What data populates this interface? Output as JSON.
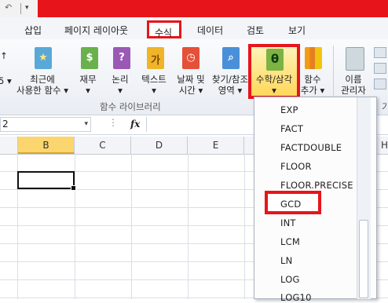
{
  "titlebar": {
    "dropdown_glyph": "▾"
  },
  "tabs": [
    {
      "label": "삽입"
    },
    {
      "label": "페이지 레이아웃"
    },
    {
      "label": "수식"
    },
    {
      "label": "데이터"
    },
    {
      "label": "검토"
    },
    {
      "label": "보기"
    }
  ],
  "ribbon": {
    "buttons": [
      {
        "label1": "최근에",
        "label2": "사용한 함수 ▾",
        "icon": "star-book-icon",
        "color": "#5aa8d8",
        "symbol": "★"
      },
      {
        "label1": "재무",
        "label2": "▾",
        "icon": "finance-book-icon",
        "color": "#6ab04c",
        "symbol": "$"
      },
      {
        "label1": "논리",
        "label2": "▾",
        "icon": "logical-book-icon",
        "color": "#9b59b6",
        "symbol": "?"
      },
      {
        "label1": "텍스트",
        "label2": "▾",
        "icon": "text-book-icon",
        "color": "#f0b429",
        "symbol": "가"
      },
      {
        "label1": "날짜 및",
        "label2": "시간 ▾",
        "icon": "datetime-book-icon",
        "color": "#e55039",
        "symbol": "◷"
      },
      {
        "label1": "찾기/참조",
        "label2": "영역 ▾",
        "icon": "lookup-book-icon",
        "color": "#4a90d9",
        "symbol": "⌕"
      },
      {
        "label1": "수학/삼각",
        "label2": "▾",
        "icon": "math-trig-book-icon",
        "color": "#7cb342",
        "symbol": "θ"
      },
      {
        "label1": "함수",
        "label2": "추가 ▾",
        "icon": "more-functions-icon",
        "color": "#f39c12",
        "symbol": ""
      },
      {
        "label1": "이름",
        "label2": "관리자",
        "icon": "name-manager-icon",
        "color": "#90a4ae",
        "symbol": ""
      }
    ],
    "left_cut_label": "↑",
    "left_cut_label2": "5 ▾",
    "group_label": "함수 라이브러리",
    "right_cut_label": "기"
  },
  "formula_bar": {
    "name_box": "2",
    "fx": "fx",
    "dots": "⋮"
  },
  "columns": [
    {
      "label": "B",
      "selected": true
    },
    {
      "label": "C",
      "selected": false
    },
    {
      "label": "D",
      "selected": false
    },
    {
      "label": "E",
      "selected": false
    },
    {
      "label": "H",
      "selected": false
    }
  ],
  "dropdown": {
    "items": [
      "EXP",
      "FACT",
      "FACTDOUBLE",
      "FLOOR",
      "FLOOR.PRECISE",
      "GCD",
      "INT",
      "LCM",
      "LN",
      "LOG",
      "LOG10"
    ],
    "highlighted": "GCD"
  },
  "colors": {
    "accent_red": "#e8141b",
    "selected_col": "#fbd56e"
  }
}
